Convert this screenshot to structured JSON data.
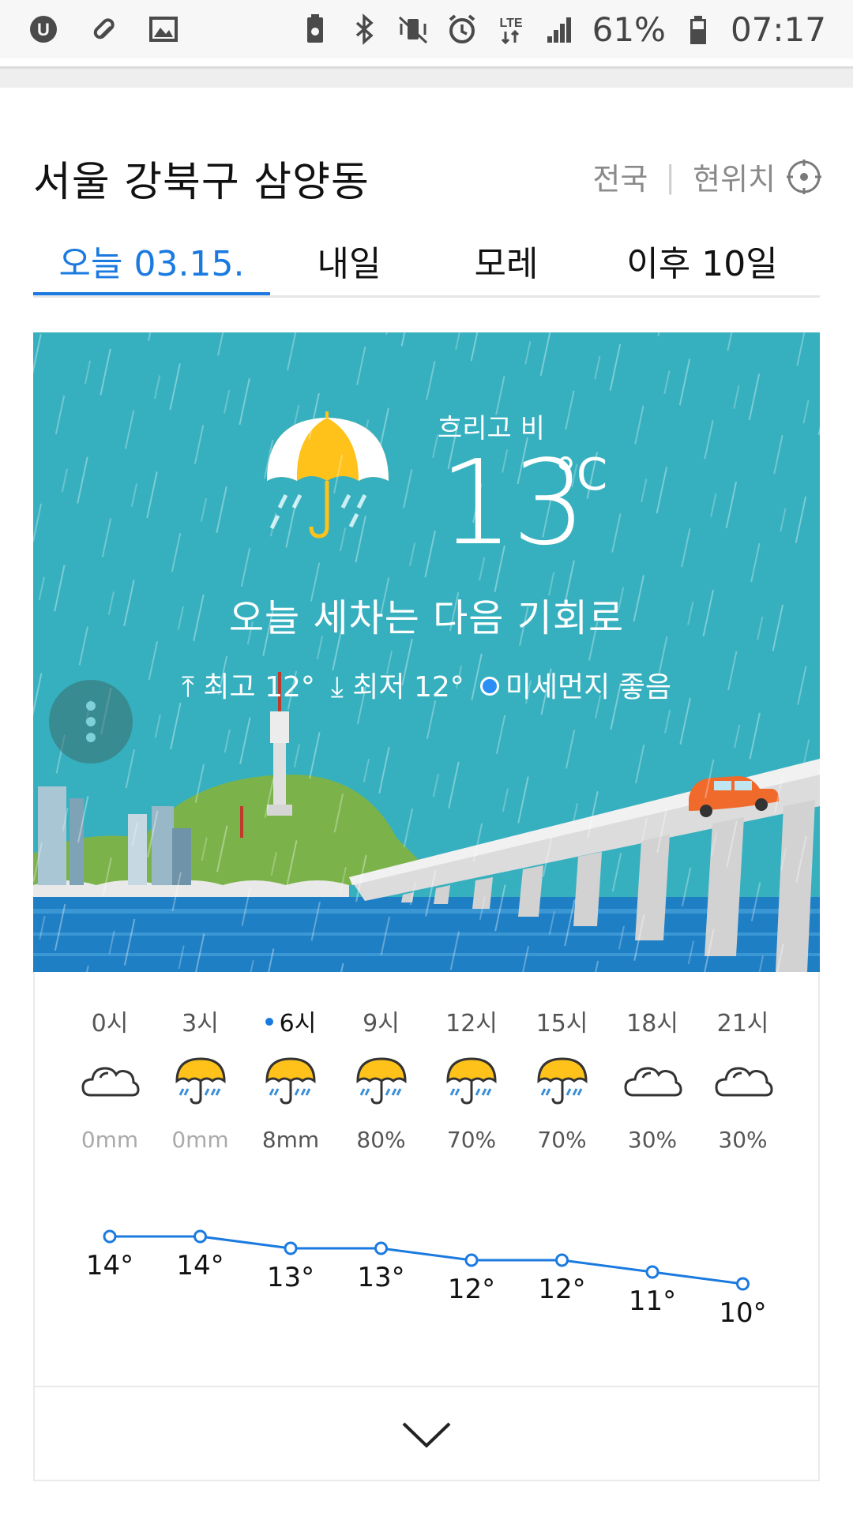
{
  "status_bar": {
    "battery": "61%",
    "time": "07:17",
    "network": "LTE",
    "left_icons": [
      "u-plus-icon",
      "pill-icon",
      "image-icon"
    ],
    "right_icons": [
      "battery-saver-icon",
      "bluetooth-icon",
      "vibrate-icon",
      "alarm-icon",
      "lte-icon",
      "signal-icon",
      "battery-icon"
    ]
  },
  "header": {
    "location": "서울 강북구 삼양동",
    "nationwide_link": "전국",
    "current_location_link": "현위치"
  },
  "tabs": [
    {
      "label": "오늘 03.15.",
      "active": true
    },
    {
      "label": "내일",
      "active": false
    },
    {
      "label": "모레",
      "active": false
    },
    {
      "label": "이후 10일",
      "active": false
    }
  ],
  "hero": {
    "condition": "흐리고 비",
    "temperature": "13",
    "unit": "°C",
    "message": "오늘 세차는 다음 기회로",
    "high_label": "최고 12°",
    "low_label": "최저 12°",
    "dust_label": "미세먼지 좋음",
    "background_color": "#36b0bf",
    "dust_color": "#2b8ef5"
  },
  "hourly": [
    {
      "time": "0시",
      "icon": "cloudy-icon",
      "precip": "0mm",
      "temp": "14°",
      "current": false
    },
    {
      "time": "3시",
      "icon": "rain-umbrella-icon",
      "precip": "0mm",
      "temp": "14°",
      "current": false
    },
    {
      "time": "6시",
      "icon": "rain-umbrella-icon",
      "precip": "8mm",
      "temp": "13°",
      "current": true
    },
    {
      "time": "9시",
      "icon": "rain-umbrella-icon",
      "precip": "80%",
      "temp": "13°",
      "current": false
    },
    {
      "time": "12시",
      "icon": "rain-umbrella-icon",
      "precip": "70%",
      "temp": "12°",
      "current": false
    },
    {
      "time": "15시",
      "icon": "rain-umbrella-icon",
      "precip": "70%",
      "temp": "12°",
      "current": false
    },
    {
      "time": "18시",
      "icon": "cloudy-icon",
      "precip": "30%",
      "temp": "11°",
      "current": false
    },
    {
      "time": "21시",
      "icon": "cloudy-icon",
      "precip": "30%",
      "temp": "10°",
      "current": false
    }
  ],
  "chart_data": {
    "type": "line",
    "categories": [
      "0시",
      "3시",
      "6시",
      "9시",
      "12시",
      "15시",
      "18시",
      "21시"
    ],
    "values": [
      14,
      14,
      13,
      13,
      12,
      12,
      11,
      10
    ],
    "ylim": [
      9,
      15
    ],
    "line_color": "#1a7ae0"
  },
  "accent_color": "#1a7ae0"
}
